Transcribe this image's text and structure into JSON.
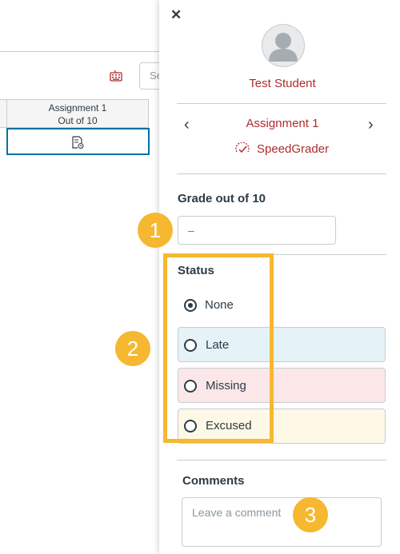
{
  "gradebook": {
    "search_placeholder": "Se",
    "column_header": {
      "title": "Assignment 1",
      "subtitle": "Out of 10"
    }
  },
  "tray": {
    "student_name": "Test Student",
    "assignment_name": "Assignment 1",
    "speedgrader_label": "SpeedGrader",
    "grade_label": "Grade out of 10",
    "grade_placeholder": "–",
    "status_label": "Status",
    "status_options": [
      {
        "label": "None",
        "selected": true
      },
      {
        "label": "Late",
        "selected": false,
        "color": "#e5f2f8"
      },
      {
        "label": "Missing",
        "selected": false,
        "color": "#fbe7e7"
      },
      {
        "label": "Excused",
        "selected": false,
        "color": "#fef8e6"
      }
    ],
    "comments_label": "Comments",
    "comment_placeholder": "Leave a comment"
  },
  "annotations": {
    "badge1": "1",
    "badge2": "2",
    "badge3": "3"
  },
  "colors": {
    "accent": "#b02b2b",
    "annotation": "#f5b830",
    "link": "#0770a3"
  },
  "icons": [
    "close-icon",
    "keyboard-icon",
    "submission-icon",
    "avatar-icon",
    "chevron-left-icon",
    "chevron-right-icon",
    "speedgrader-icon"
  ]
}
